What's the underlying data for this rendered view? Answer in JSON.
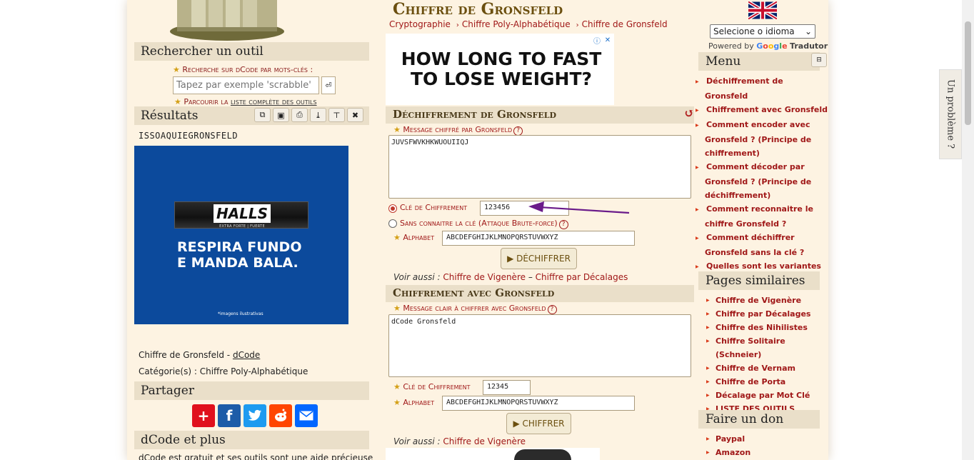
{
  "left": {
    "search_header": "Rechercher un outil",
    "search_hint": "Recherche sur dCode par mots-clés :",
    "search_placeholder": "Tapez par exemple 'scrabble'",
    "browse_prefix": "Parcourir la ",
    "browse_link": "liste complète des outils",
    "results_header": "Résultats",
    "result_text": "ISSOAQUIEGRONSFELD",
    "page_ref_prefix": "Chiffre de Gronsfeld - ",
    "page_ref_link": "dCode",
    "category": "Catégorie(s) : Chiffre Poly-Alphabétique",
    "share_header": "Partager",
    "dcode_header": "dCode et plus",
    "bottom_text": "dCode est gratuit et ses outils sont une aide précieuse"
  },
  "ad_halls": {
    "logo": "HALLS",
    "sub": "EXTRA FORTE | FUERTE",
    "slogan_line1": "RESPIRA FUNDO",
    "slogan_line2": "E MANDA BALA.",
    "note": "*imagens ilustrativas"
  },
  "ad_fast": {
    "line1": "HOW LONG TO FAST",
    "line2": "TO LOSE WEIGHT?"
  },
  "center": {
    "title": "Chiffre de Gronsfeld",
    "breadcrumbs": [
      "Cryptographie",
      "Chiffre Poly-Alphabétique",
      "Chiffre de Gronsfeld"
    ],
    "decrypt": {
      "header": "Déchiffrement de Gronsfeld",
      "message_label": "Message chiffré par Gronsfeld",
      "message_value": "JUVSFWVKHKWUOUIIQJ",
      "key_label": "Clé de Chiffrement",
      "key_value": "123456",
      "brute_label": "Sans connaitre la clé (Attaque Brute-force)",
      "alphabet_label": "Alphabet",
      "alphabet_value": "ABCDEFGHIJKLMNOPQRSTUVWXYZ",
      "button": "▶ DÉCHIFFRER",
      "see_also_prefix": "Voir aussi : ",
      "see_also_1": "Chiffre de Vigenère",
      "see_also_sep": " – ",
      "see_also_2": "Chiffre par Décalages"
    },
    "encrypt": {
      "header": "Chiffrement avec Gronsfeld",
      "message_label": "Message clair à chiffrer avec Gronsfeld",
      "message_value": "dCode Gronsfeld",
      "key_label": "Clé de Chiffrement",
      "key_value": "12345",
      "alphabet_label": "Alphabet",
      "alphabet_value": "ABCDEFGHIJKLMNOPQRSTUVWXYZ",
      "button": "▶ CHIFFRER",
      "see_also_prefix": "Voir aussi : ",
      "see_also_1": "Chiffre de Vigenère"
    }
  },
  "right": {
    "language_select": "Selecione o idioma",
    "powered_by": "Powered by",
    "translator": "Tradutor",
    "menu_header": "Menu",
    "menu_items": [
      "Déchiffrement de Gronsfeld",
      "Chiffrement avec Gronsfeld",
      "Comment encoder avec Gronsfeld ? (Principe de chiffrement)",
      "Comment décoder par Gronsfeld ? (Principe de déchiffrement)",
      "Comment reconnaitre le chiffre Gronsfeld ?",
      "Comment déchiffrer Gronsfeld sans la clé ?",
      "Quelles sont les variantes du chiffre Gronsfeld ?"
    ],
    "similar_header": "Pages similaires",
    "similar_items": [
      "Chiffre de Vigenère",
      "Chiffre par Décalages",
      "Chiffre des Nihilistes",
      "Chiffre Solitaire (Schneier)",
      "Chiffre de Vernam",
      "Chiffre de Porta",
      "Décalage par Mot Clé",
      "LISTE DES OUTILS DCODE"
    ],
    "donate_header": "Faire un don",
    "donate_items": [
      "Paypal",
      "Amazon"
    ]
  },
  "feedback_tab": "Un problème ?",
  "icons": {
    "search_button": "search-icon",
    "result_tools": [
      "copy-icon",
      "save-icon",
      "print-icon",
      "download-icon",
      "pin-icon",
      "close-icon"
    ],
    "share": [
      "addthis-icon",
      "facebook-icon",
      "twitter-icon",
      "reddit-icon",
      "email-icon"
    ]
  },
  "colors": {
    "accent_red": "#a01818",
    "title_brown": "#6b4f0f",
    "panel_bg": "#eadfc9",
    "arrow_purple": "#6a1b8a"
  }
}
